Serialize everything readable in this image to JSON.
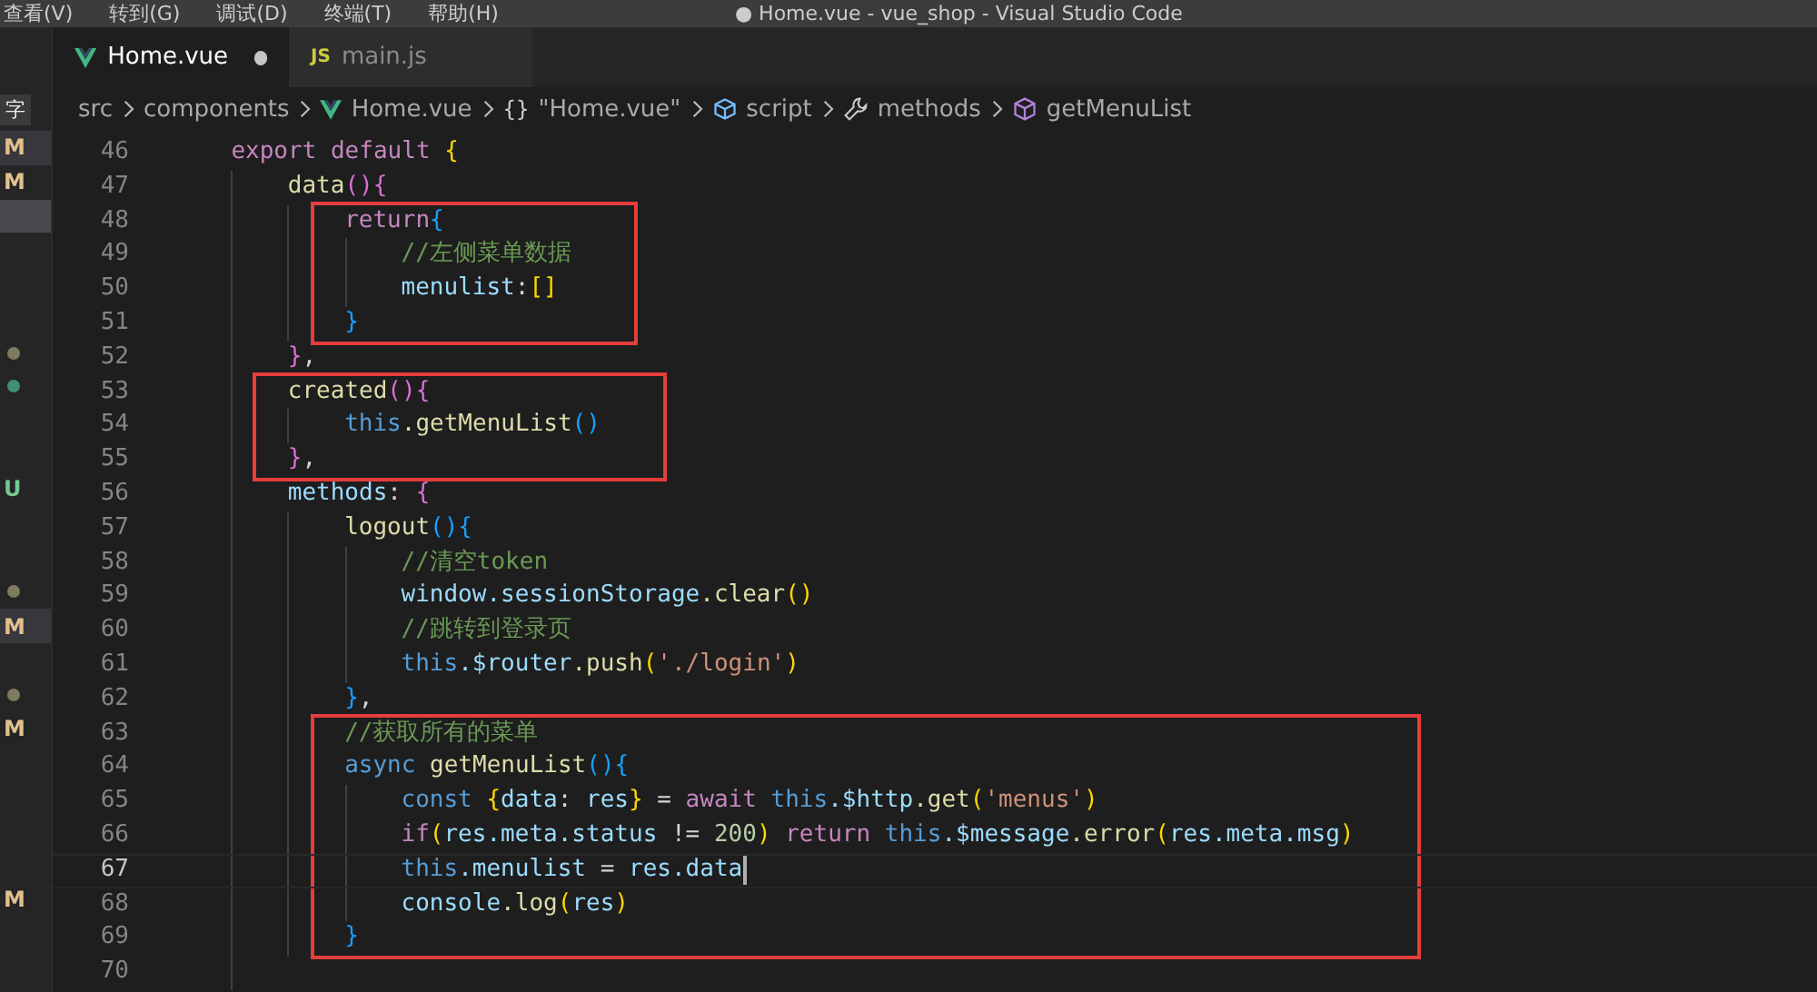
{
  "title_bar": {
    "menus": [
      "查看(V)",
      "转到(G)",
      "调试(D)",
      "终端(T)",
      "帮助(H)"
    ],
    "title": "● Home.vue - vue_shop - Visual Studio Code"
  },
  "tabs": [
    {
      "label": "Home.vue",
      "kind": "vue",
      "selected": true,
      "modified": true
    },
    {
      "label": "main.js",
      "kind": "js",
      "icon_text": "JS",
      "selected": false,
      "modified": false
    }
  ],
  "sidebar_label": "字",
  "breadcrumb": [
    {
      "kind": "text",
      "label": "src"
    },
    {
      "kind": "text",
      "label": "components"
    },
    {
      "kind": "vue",
      "label": "Home.vue"
    },
    {
      "kind": "braces",
      "icon_text": "{}",
      "label": "\"Home.vue\""
    },
    {
      "kind": "script",
      "label": "script"
    },
    {
      "kind": "wrench",
      "label": "methods"
    },
    {
      "kind": "cube",
      "label": "getMenuList"
    }
  ],
  "explorer_rows": [
    {
      "badge": "M",
      "color": "#e2c08d",
      "selected": false,
      "highlighted": true
    },
    {
      "badge": "M",
      "color": "#e2c08d",
      "selected": false,
      "highlighted": false
    },
    {
      "selected": true,
      "highlighted": false
    },
    {
      "selected": false,
      "highlighted": false
    },
    {
      "selected": false,
      "highlighted": false
    },
    {
      "selected": false,
      "highlighted": false
    },
    {
      "color": "#7d7a5e",
      "selected": false,
      "highlighted": false
    },
    {
      "color": "#3f8f74",
      "selected": false,
      "highlighted": false
    },
    {
      "selected": false,
      "highlighted": false
    },
    {
      "selected": false,
      "highlighted": false
    },
    {
      "badge": "U",
      "color": "#73c991",
      "selected": false,
      "highlighted": false
    },
    {
      "selected": false,
      "highlighted": false
    },
    {
      "selected": false,
      "highlighted": false
    },
    {
      "color": "#7d7a5e",
      "selected": false,
      "highlighted": false
    },
    {
      "badge": "M",
      "color": "#e2c08d",
      "selected": false,
      "highlighted": true
    },
    {
      "selected": false,
      "highlighted": false
    },
    {
      "color": "#7d7a5e",
      "selected": false,
      "highlighted": false
    },
    {
      "badge": "M",
      "color": "#e2c08d",
      "selected": false,
      "highlighted": false
    },
    {
      "selected": false,
      "highlighted": false
    },
    {
      "selected": false,
      "highlighted": false
    },
    {
      "selected": false,
      "highlighted": false
    },
    {
      "selected": false,
      "highlighted": false
    },
    {
      "badge": "M",
      "color": "#e2c08d",
      "selected": false,
      "highlighted": false
    }
  ],
  "code": [
    {
      "kind": "indent",
      "children": [
        {
          "kind": "line",
          "number": "46",
          "tokens": [
            {
              "kind": "kw",
              "text": "export"
            },
            {
              "kind": "kw",
              "text": " default"
            },
            {
              "kind": "b1",
              "text": " {"
            }
          ]
        },
        {
          "kind": "indent",
          "children": [
            {
              "kind": "line",
              "number": "47",
              "tokens": [
                {
                  "kind": "fn",
                  "text": "data"
                },
                {
                  "kind": "b2",
                  "text": "(){"
                }
              ]
            },
            {
              "kind": "indent",
              "children": [
                {
                  "kind": "box",
                  "children": [
                    {
                      "kind": "line",
                      "number": "48",
                      "tokens": [
                        {
                          "kind": "kw",
                          "text": "return"
                        },
                        {
                          "kind": "b3",
                          "text": "{"
                        }
                      ]
                    },
                    {
                      "kind": "indent",
                      "children": [
                        {
                          "kind": "line",
                          "number": "49",
                          "tokens": [
                            {
                              "kind": "comment",
                              "text": "//左侧菜单数据"
                            }
                          ]
                        },
                        {
                          "kind": "line",
                          "number": "50",
                          "tokens": [
                            {
                              "kind": "prop",
                              "text": "menulist"
                            },
                            {
                              "kind": "plain",
                              "text": ":"
                            },
                            {
                              "kind": "b1",
                              "text": "[]"
                            }
                          ]
                        }
                      ]
                    },
                    {
                      "kind": "line",
                      "number": "51",
                      "tokens": [
                        {
                          "kind": "b3",
                          "text": "}"
                        }
                      ]
                    }
                  ]
                }
              ]
            },
            {
              "kind": "line",
              "number": "52",
              "tokens": [
                {
                  "kind": "b2",
                  "text": "}"
                },
                {
                  "kind": "plain",
                  "text": ","
                }
              ]
            },
            {
              "kind": "box",
              "children": [
                {
                  "kind": "line",
                  "number": "53",
                  "tokens": [
                    {
                      "kind": "fn",
                      "text": "created"
                    },
                    {
                      "kind": "b2",
                      "text": "(){"
                    }
                  ]
                },
                {
                  "kind": "indent",
                  "children": [
                    {
                      "kind": "line",
                      "number": "54",
                      "tokens": [
                        {
                          "kind": "this",
                          "text": "this"
                        },
                        {
                          "kind": "fn",
                          "text": ".getMenuList"
                        },
                        {
                          "kind": "b3",
                          "text": "()"
                        }
                      ]
                    }
                  ]
                },
                {
                  "kind": "line",
                  "number": "55",
                  "tokens": [
                    {
                      "kind": "b2",
                      "text": "}"
                    },
                    {
                      "kind": "plain",
                      "text": ","
                    }
                  ]
                }
              ]
            },
            {
              "kind": "line",
              "number": "56",
              "tokens": [
                {
                  "kind": "prop",
                  "text": "methods"
                },
                {
                  "kind": "plain",
                  "text": ":"
                },
                {
                  "kind": "b2",
                  "text": " {"
                }
              ]
            },
            {
              "kind": "indent",
              "children": [
                {
                  "kind": "line",
                  "number": "57",
                  "tokens": [
                    {
                      "kind": "fn",
                      "text": "logout"
                    },
                    {
                      "kind": "b3",
                      "text": "(){"
                    }
                  ]
                },
                {
                  "kind": "indent",
                  "children": [
                    {
                      "kind": "line",
                      "number": "58",
                      "tokens": [
                        {
                          "kind": "comment",
                          "text": "//清空token"
                        }
                      ]
                    },
                    {
                      "kind": "line",
                      "number": "59",
                      "tokens": [
                        {
                          "kind": "prop",
                          "text": "window"
                        },
                        {
                          "kind": "prop",
                          "text": ".sessionStorage"
                        },
                        {
                          "kind": "fn",
                          "text": ".clear"
                        },
                        {
                          "kind": "b1",
                          "text": "()"
                        }
                      ]
                    },
                    {
                      "kind": "line",
                      "number": "60",
                      "tokens": [
                        {
                          "kind": "comment",
                          "text": "//跳转到登录页"
                        }
                      ]
                    },
                    {
                      "kind": "line",
                      "number": "61",
                      "tokens": [
                        {
                          "kind": "this",
                          "text": "this"
                        },
                        {
                          "kind": "prop",
                          "text": ".$router"
                        },
                        {
                          "kind": "fn",
                          "text": ".push"
                        },
                        {
                          "kind": "b1",
                          "text": "("
                        },
                        {
                          "kind": "str",
                          "text": "'./login'"
                        },
                        {
                          "kind": "b1",
                          "text": ")"
                        }
                      ]
                    }
                  ]
                },
                {
                  "kind": "line",
                  "number": "62",
                  "tokens": [
                    {
                      "kind": "b3",
                      "text": "}"
                    },
                    {
                      "kind": "plain",
                      "text": ","
                    }
                  ]
                },
                {
                  "kind": "box",
                  "children": [
                    {
                      "kind": "line",
                      "number": "63",
                      "tokens": [
                        {
                          "kind": "comment",
                          "text": "//获取所有的菜单"
                        }
                      ]
                    },
                    {
                      "kind": "line",
                      "number": "64",
                      "tokens": [
                        {
                          "kind": "this",
                          "text": "async"
                        },
                        {
                          "kind": "fn",
                          "text": " getMenuList"
                        },
                        {
                          "kind": "b3",
                          "text": "(){"
                        }
                      ]
                    },
                    {
                      "kind": "indent",
                      "children": [
                        {
                          "kind": "line",
                          "number": "65",
                          "tokens": [
                            {
                              "kind": "this",
                              "text": "const"
                            },
                            {
                              "kind": "b1",
                              "text": " {"
                            },
                            {
                              "kind": "prop",
                              "text": "data"
                            },
                            {
                              "kind": "plain",
                              "text": ":"
                            },
                            {
                              "kind": "prop",
                              "text": " res"
                            },
                            {
                              "kind": "b1",
                              "text": "}"
                            },
                            {
                              "kind": "plain",
                              "text": " ="
                            },
                            {
                              "kind": "kw",
                              "text": " await"
                            },
                            {
                              "kind": "this",
                              "text": " this"
                            },
                            {
                              "kind": "prop",
                              "text": ".$http"
                            },
                            {
                              "kind": "fn",
                              "text": ".get"
                            },
                            {
                              "kind": "b1",
                              "text": "("
                            },
                            {
                              "kind": "str",
                              "text": "'menus'"
                            },
                            {
                              "kind": "b1",
                              "text": ")"
                            }
                          ]
                        },
                        {
                          "kind": "line",
                          "number": "66",
                          "tokens": [
                            {
                              "kind": "kw",
                              "text": "if"
                            },
                            {
                              "kind": "b1",
                              "text": "("
                            },
                            {
                              "kind": "prop",
                              "text": "res"
                            },
                            {
                              "kind": "prop",
                              "text": ".meta"
                            },
                            {
                              "kind": "prop",
                              "text": ".status"
                            },
                            {
                              "kind": "plain",
                              "text": " !="
                            },
                            {
                              "kind": "num",
                              "text": " 200"
                            },
                            {
                              "kind": "b1",
                              "text": ")"
                            },
                            {
                              "kind": "kw",
                              "text": " return"
                            },
                            {
                              "kind": "this",
                              "text": " this"
                            },
                            {
                              "kind": "prop",
                              "text": ".$message"
                            },
                            {
                              "kind": "fn",
                              "text": ".error"
                            },
                            {
                              "kind": "b1",
                              "text": "("
                            },
                            {
                              "kind": "prop",
                              "text": "res"
                            },
                            {
                              "kind": "prop",
                              "text": ".meta"
                            },
                            {
                              "kind": "prop",
                              "text": ".msg"
                            },
                            {
                              "kind": "b1",
                              "text": ")"
                            }
                          ]
                        },
                        {
                          "kind": "line",
                          "number": "67",
                          "current": true,
                          "tokens": [
                            {
                              "kind": "this",
                              "text": "this"
                            },
                            {
                              "kind": "prop",
                              "text": ".menulist"
                            },
                            {
                              "kind": "plain",
                              "text": " ="
                            },
                            {
                              "kind": "prop",
                              "text": " res"
                            },
                            {
                              "kind": "prop",
                              "text": ".data"
                            }
                          ]
                        },
                        {
                          "kind": "line",
                          "number": "68",
                          "tokens": [
                            {
                              "kind": "prop",
                              "text": "console"
                            },
                            {
                              "kind": "fn",
                              "text": ".log"
                            },
                            {
                              "kind": "b1",
                              "text": "("
                            },
                            {
                              "kind": "prop",
                              "text": "res"
                            },
                            {
                              "kind": "b1",
                              "text": ")"
                            }
                          ]
                        }
                      ]
                    },
                    {
                      "kind": "line",
                      "number": "69",
                      "tokens": [
                        {
                          "kind": "b3",
                          "text": "}"
                        }
                      ]
                    }
                  ]
                }
              ]
            },
            {
              "kind": "line",
              "number": "70"
            }
          ]
        }
      ]
    }
  ]
}
